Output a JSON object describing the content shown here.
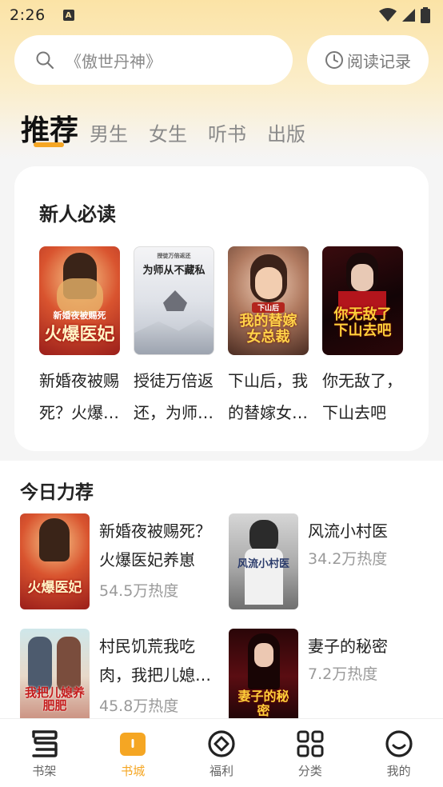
{
  "status_bar": {
    "time": "2:26",
    "app_icon_letter": "A"
  },
  "search": {
    "placeholder": "《傲世丹神》",
    "history_label": "阅读记录"
  },
  "tabs": [
    {
      "label": "推荐",
      "active": true
    },
    {
      "label": "男生"
    },
    {
      "label": "女生"
    },
    {
      "label": "听书"
    },
    {
      "label": "出版"
    }
  ],
  "new_reader": {
    "title": "新人必读",
    "books": [
      {
        "name": "新婚夜被赐死？火爆医妃",
        "cover_text": "火爆医妃",
        "cover_sub": "新婚夜被赐死"
      },
      {
        "name": "授徒万倍返还，为师从不藏私",
        "cover_text": "为师从不藏私",
        "cover_sub": "授徒万倍返还"
      },
      {
        "name": "下山后，我的替嫁女总裁",
        "cover_text": "我的替嫁女总裁",
        "cover_sub": "下山后"
      },
      {
        "name": "你无敌了，下山去吧",
        "cover_text": "你无敌了下山去吧",
        "cover_sub": ""
      }
    ]
  },
  "today": {
    "title": "今日力荐",
    "items": [
      {
        "name": "新婚夜被赐死？火爆医妃养崽",
        "heat": "54.5万热度",
        "cover_text": "火爆医妃"
      },
      {
        "name": "风流小村医",
        "heat": "34.2万热度",
        "cover_text": "风流小村医"
      },
      {
        "name": "村民饥荒我吃肉，我把儿媳养肥肥",
        "heat": "45.8万热度",
        "cover_text": "我把儿媳养肥肥"
      },
      {
        "name": "妻子的秘密",
        "heat": "7.2万热度",
        "cover_text": "妻子的秘密"
      }
    ]
  },
  "bottom_nav": [
    {
      "label": "书架",
      "icon": "bookshelf-icon"
    },
    {
      "label": "书城",
      "icon": "bookstore-icon",
      "active": true
    },
    {
      "label": "福利",
      "icon": "welfare-icon"
    },
    {
      "label": "分类",
      "icon": "category-icon"
    },
    {
      "label": "我的",
      "icon": "profile-icon"
    }
  ],
  "colors": {
    "accent": "#f5a623",
    "header_bg": "#fbe3a6"
  }
}
